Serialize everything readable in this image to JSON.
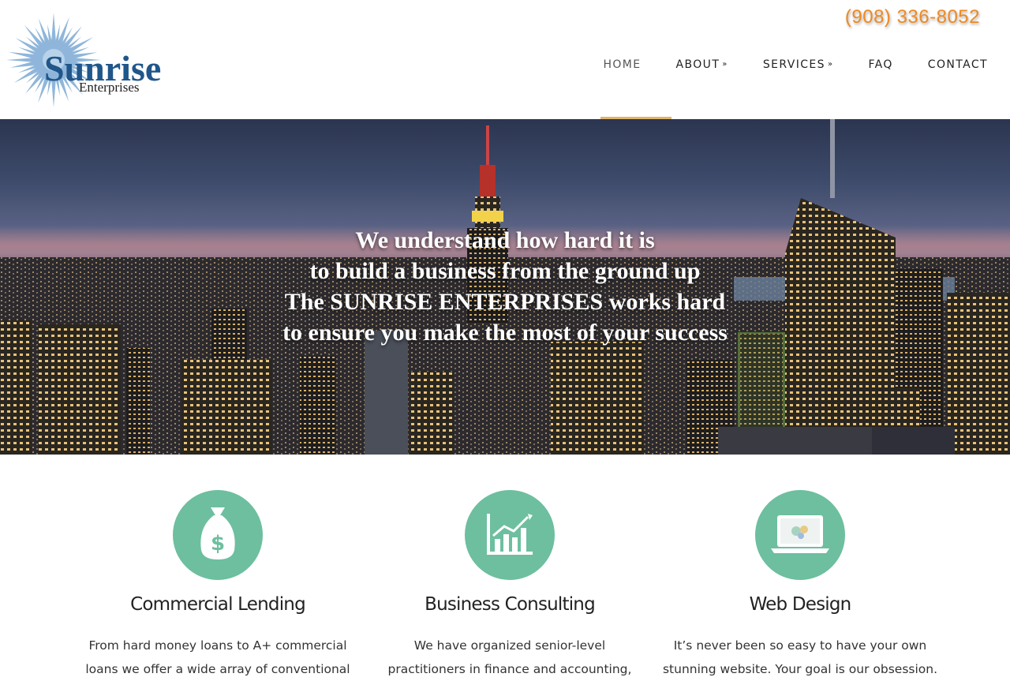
{
  "brand": {
    "name": "Sunrise",
    "tagline": "Enterprises",
    "phone": "(908) 336-8052"
  },
  "nav": {
    "items": [
      {
        "label": "HOME",
        "dropdown": false,
        "active": true
      },
      {
        "label": "ABOUT",
        "dropdown": true
      },
      {
        "label": "SERVICES",
        "dropdown": true
      },
      {
        "label": "FAQ",
        "dropdown": false
      },
      {
        "label": "CONTACT",
        "dropdown": false
      }
    ],
    "dropdown_icon": "double-chevron-down-icon"
  },
  "hero": {
    "lines": [
      "We understand how hard it is",
      "to build a business from the ground up",
      "The SUNRISE ENTERPRISES works hard",
      "to ensure you make the most of your success"
    ]
  },
  "features": [
    {
      "icon": "money-bag-icon",
      "title": "Commercial Lending",
      "text_lines": [
        "From hard money loans to A+ commercial",
        "loans we offer a wide array of conventional"
      ]
    },
    {
      "icon": "growth-chart-icon",
      "title": "Business Consulting",
      "text_lines": [
        "We have organized senior-level",
        "practitioners in finance and accounting,"
      ]
    },
    {
      "icon": "laptop-icon",
      "title": "Web Design",
      "text_lines": [
        "It’s never been so easy to have your own",
        "stunning website. Your goal is our obsession."
      ]
    }
  ],
  "colors": {
    "accent": "#6dbf9f",
    "brand_blue": "#20568a",
    "phone_orange": "#ee8a22",
    "active_underline": "#e0b46a"
  }
}
